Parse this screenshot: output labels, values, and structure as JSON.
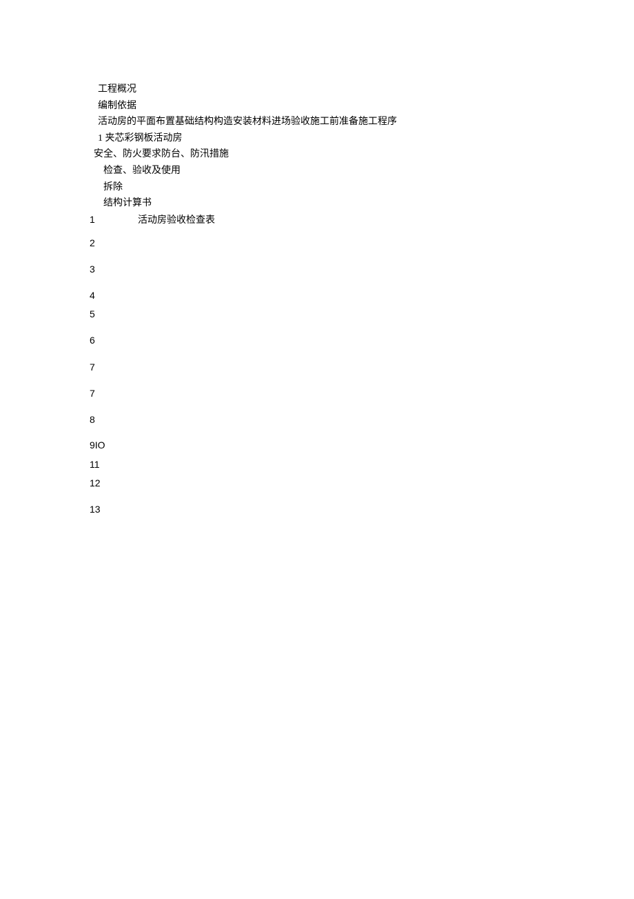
{
  "lines": {
    "l1": "工程概况",
    "l2": "编制依据",
    "l3": "活动房的平面布置基础结构构造安装材料进场验收施工前准备施工程序",
    "l4": "1 夹芯彩钢板活动房",
    "l5": "安全、防火要求防台、防汛措施",
    "l6": "检查、验收及使用",
    "l7": "拆除",
    "l8": "结构计算书",
    "l9": "活动房验收检查表"
  },
  "numbers": {
    "n1": "1",
    "n2": "2",
    "n3": "3",
    "n4": "4",
    "n5": "5",
    "n6": "6",
    "n7": "7",
    "n7b": "7",
    "n8": "8",
    "n9": "9IO",
    "n11": "11",
    "n12": "12",
    "n13": "13"
  }
}
